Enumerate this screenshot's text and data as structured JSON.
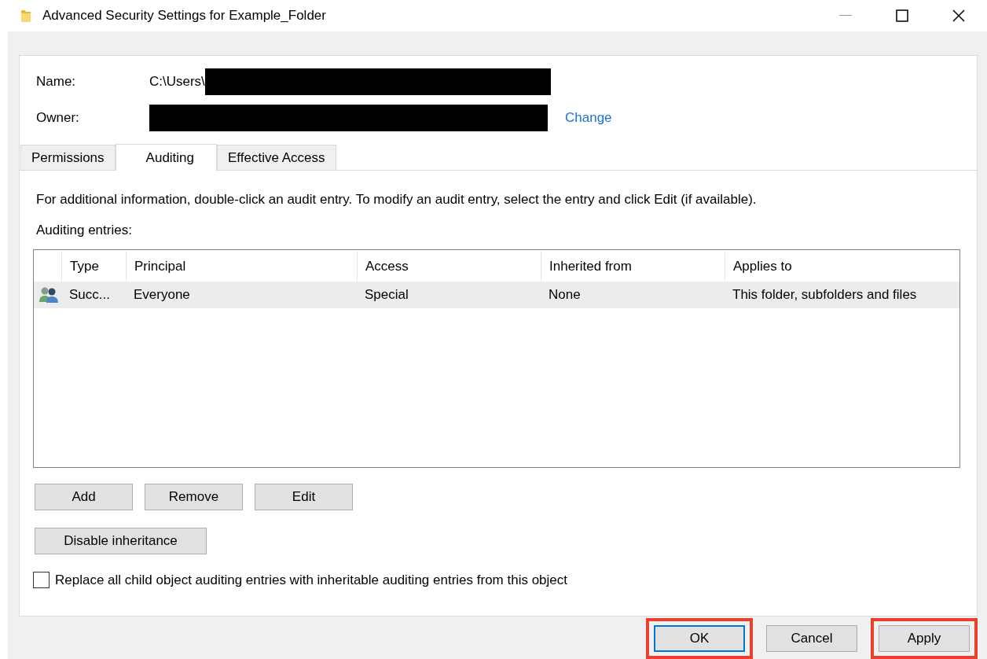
{
  "window": {
    "title": "Advanced Security Settings for Example_Folder"
  },
  "info": {
    "name_label": "Name:",
    "name_value": "C:\\Users\\",
    "owner_label": "Owner:",
    "change_link": "Change"
  },
  "tabs": [
    {
      "label": "Permissions",
      "selected": false
    },
    {
      "label": "Auditing",
      "selected": true
    },
    {
      "label": "Effective Access",
      "selected": false
    }
  ],
  "description": "For additional information, double-click an audit entry. To modify an audit entry, select the entry and click Edit (if available).",
  "entries_label": "Auditing entries:",
  "table": {
    "columns": [
      "Type",
      "Principal",
      "Access",
      "Inherited from",
      "Applies to"
    ],
    "rows": [
      {
        "cells": [
          "Succ...",
          "Everyone",
          "Special",
          "None",
          "This folder, subfolders and files"
        ],
        "selected": true
      }
    ]
  },
  "entry_buttons": [
    "Add",
    "Remove",
    "Edit"
  ],
  "inheritance_button": "Disable inheritance",
  "replace_checkbox": {
    "label": "Replace all child object auditing entries with inheritable auditing entries from this object",
    "checked": false
  },
  "dialog_buttons": [
    {
      "label": "OK",
      "default": true,
      "highlighted": true
    },
    {
      "label": "Cancel",
      "default": false,
      "highlighted": false
    },
    {
      "label": "Apply",
      "default": false,
      "highlighted": true
    }
  ]
}
